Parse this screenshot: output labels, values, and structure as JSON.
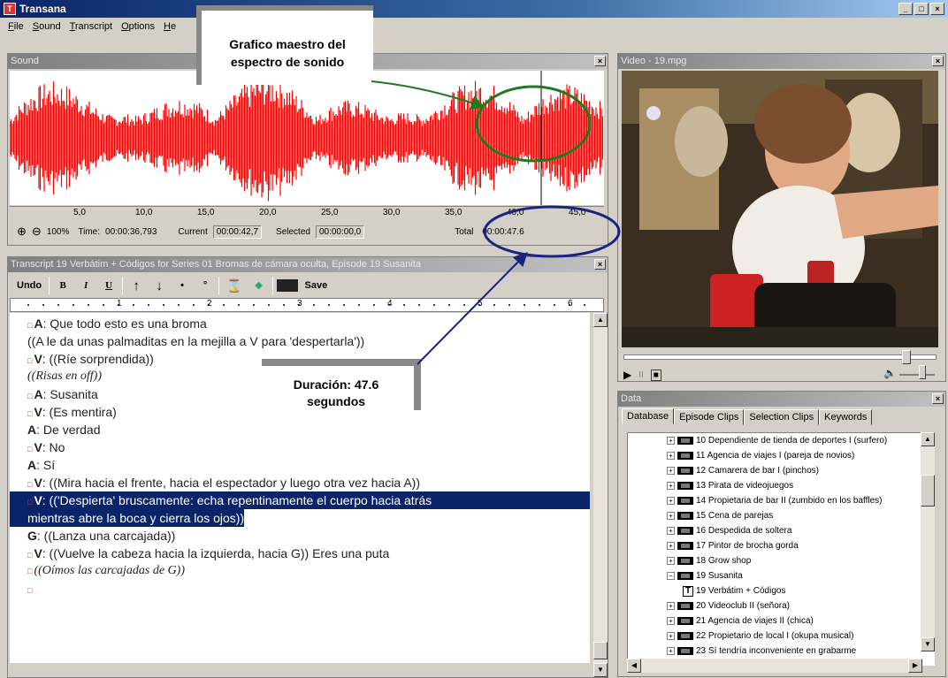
{
  "window": {
    "title": "Transana"
  },
  "menu": [
    {
      "label": "File",
      "u": "F",
      "rest": "ile"
    },
    {
      "label": "Sound",
      "u": "S",
      "rest": "ound"
    },
    {
      "label": "Transcript",
      "u": "T",
      "rest": "ranscript"
    },
    {
      "label": "Options",
      "u": "O",
      "rest": "ptions"
    },
    {
      "label": "Help",
      "u": "H",
      "rest": "e"
    }
  ],
  "sound": {
    "title": "Sound",
    "ruler_ticks": [
      "5,0",
      "10,0",
      "15,0",
      "20,0",
      "25,0",
      "30,0",
      "35,0",
      "40,0",
      "45,0"
    ],
    "zoom": "100%",
    "time_label": "Time:",
    "time_value": "00:00:36,793",
    "current_label": "Current",
    "current_value": "00:00:42,7",
    "selected_label": "Selected",
    "selected_value": "00:00:00,0",
    "total_label": "Total",
    "total_value": "00:00:47.6",
    "wave_color": "#ff0000"
  },
  "transcript": {
    "title": "Transcript 19 Verbátim + Códigos for Series 01 Bromas de cámara oculta, Episode 19 Susanita",
    "toolbar": {
      "undo": "Undo",
      "bold": "B",
      "italic": "I",
      "underline": "U",
      "up": "↑",
      "down": "↓",
      "dot": "•",
      "circle": "°",
      "save": "Save"
    },
    "ruler_nums": [
      "1",
      "2",
      "3",
      "4",
      "5",
      "6"
    ],
    "lines": [
      {
        "mark": true,
        "speaker": "A",
        "text": ": Que todo esto es una broma",
        "style": "normal"
      },
      {
        "mark": false,
        "speaker": "",
        "text": "((A le da unas palmaditas en la mejilla a V para 'despertarla'))",
        "style": "normal"
      },
      {
        "mark": true,
        "speaker": "V",
        "text": ": ((Ríe sorprendida))",
        "style": "normal"
      },
      {
        "mark": false,
        "speaker": "",
        "text": "((Risas en off))",
        "style": "italic"
      },
      {
        "mark": true,
        "speaker": "A",
        "text": ": Susanita",
        "style": "normal"
      },
      {
        "mark": true,
        "speaker": "V",
        "text": ": (Es mentira)",
        "style": "normal"
      },
      {
        "mark": false,
        "speaker": "A",
        "text": ": De verdad",
        "style": "normal"
      },
      {
        "mark": true,
        "speaker": "V",
        "text": ": No",
        "style": "normal"
      },
      {
        "mark": false,
        "speaker": "A",
        "text": ": Sí",
        "style": "normal"
      },
      {
        "mark": true,
        "speaker": "V",
        "text": ": ((Mira hacia el frente, hacia el espectador y luego otra vez hacia A))",
        "style": "normal"
      },
      {
        "mark": true,
        "speaker": "V",
        "text": ": (('Despierta' bruscamente: echa repentinamente el cuerpo hacia atrás",
        "style": "sel"
      },
      {
        "mark": false,
        "speaker": "",
        "text": "mientras abre la boca y cierra los ojos))",
        "style": "sel2"
      },
      {
        "mark": false,
        "speaker": "G",
        "text": ": ((Lanza una carcajada))",
        "style": "normal"
      },
      {
        "mark": true,
        "speaker": "V",
        "text": ": ((Vuelve la cabeza hacia la izquierda, hacia G)) Eres una puta",
        "style": "normal"
      },
      {
        "mark": true,
        "speaker": "",
        "text": "((Oímos las carcajadas de G))",
        "style": "italic"
      },
      {
        "mark": true,
        "speaker": "",
        "text": "",
        "style": "normal"
      }
    ]
  },
  "video": {
    "title": "Video - 19.mpg",
    "play": "▶",
    "pause": "II",
    "stop": "■",
    "volume": "🔈"
  },
  "data": {
    "title": "Data",
    "tabs": [
      "Database",
      "Episode Clips",
      "Selection Clips",
      "Keywords"
    ],
    "tree": [
      {
        "kind": "episode",
        "exp": "+",
        "label": "10 Dependiente de tienda de deportes I (surfero)"
      },
      {
        "kind": "episode",
        "exp": "+",
        "label": "11 Agencia de viajes I (pareja de novios)"
      },
      {
        "kind": "episode",
        "exp": "+",
        "label": "12 Camarera de bar I (pinchos)"
      },
      {
        "kind": "episode",
        "exp": "+",
        "label": "13 Pirata de videojuegos"
      },
      {
        "kind": "episode",
        "exp": "+",
        "label": "14 Propietaria de bar II (zumbido en los baffles)"
      },
      {
        "kind": "episode",
        "exp": "+",
        "label": "15 Cena de parejas"
      },
      {
        "kind": "episode",
        "exp": "+",
        "label": "16 Despedida de soltera"
      },
      {
        "kind": "episode",
        "exp": "+",
        "label": "17 Pintor de brocha gorda"
      },
      {
        "kind": "episode",
        "exp": "+",
        "label": "18 Grow shop"
      },
      {
        "kind": "episode",
        "exp": "−",
        "label": "19 Susanita"
      },
      {
        "kind": "transcript",
        "exp": "",
        "label": "19 Verbátim + Códigos"
      },
      {
        "kind": "episode",
        "exp": "+",
        "label": "20 Videoclub II (señora)"
      },
      {
        "kind": "episode",
        "exp": "+",
        "label": "21 Agencia de viajes II (chica)"
      },
      {
        "kind": "episode",
        "exp": "+",
        "label": "22 Propietario de local I (okupa musical)"
      },
      {
        "kind": "episode",
        "exp": "+",
        "label": "23 Sí tendría inconveniente en grabarme"
      }
    ]
  },
  "annotations": {
    "top_line1": "Grafico maestro del",
    "top_line2": "espectro de sonido",
    "mid_line1": "Duración: 47.6",
    "mid_line2": "segundos"
  }
}
